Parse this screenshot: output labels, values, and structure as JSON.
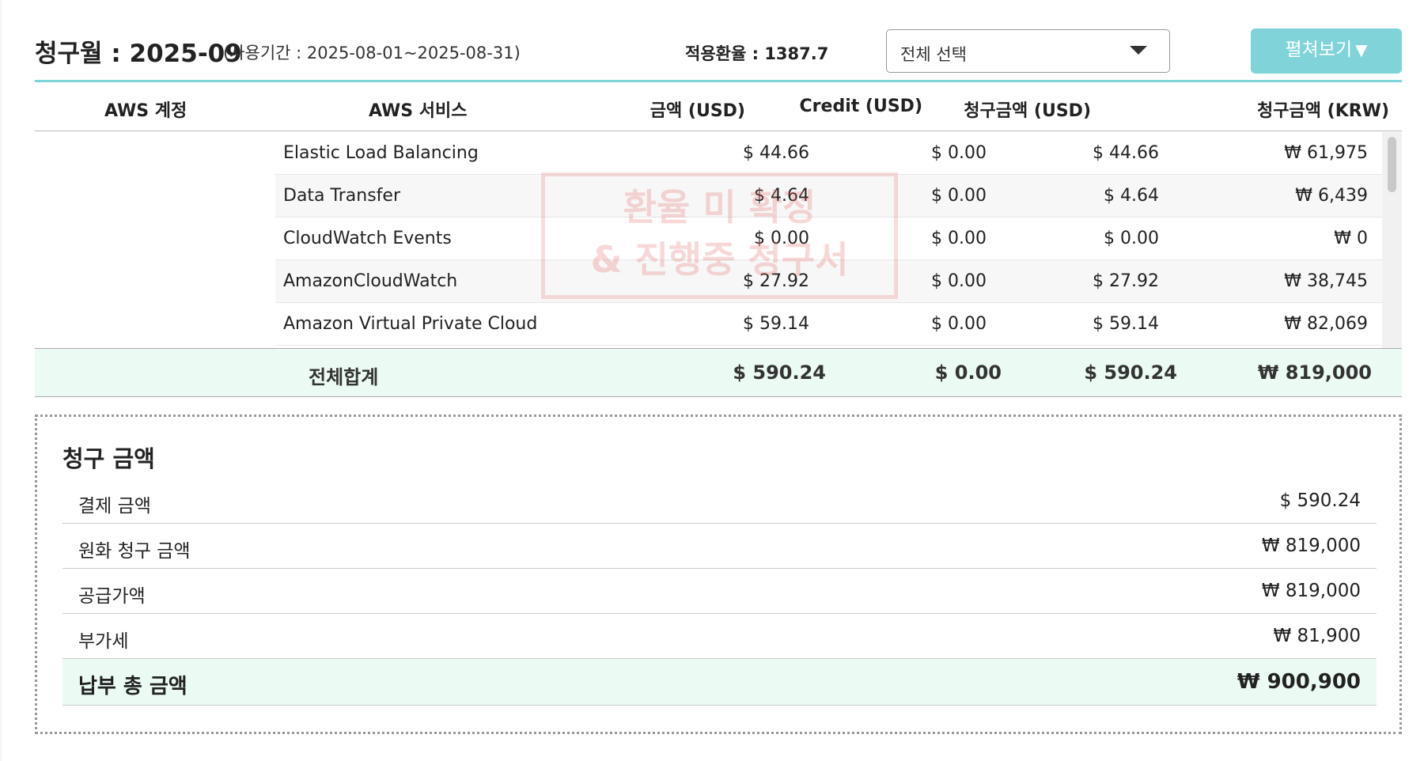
{
  "header": {
    "title": "청구월 : 2025-09",
    "period": "(사용기간 : 2025-08-01~2025-08-31)",
    "rate_label": "적용환율 : ",
    "rate_value": "1387.7",
    "select_value": "전체 선택",
    "expand_label": "펼쳐보기",
    "expand_icon": "▼"
  },
  "table": {
    "columns": [
      "AWS 계정",
      "AWS 서비스",
      "금액 (USD)",
      "Credit (USD)",
      "청구금액 (USD)",
      "청구금액 (KRW)"
    ],
    "rows": [
      {
        "service": "Elastic Load Balancing",
        "amount": "$ 44.66",
        "credit": "$ 0.00",
        "bill_usd": "$ 44.66",
        "bill_krw": "₩ 61,975"
      },
      {
        "service": "Data Transfer",
        "amount": "$ 4.64",
        "credit": "$ 0.00",
        "bill_usd": "$ 4.64",
        "bill_krw": "₩ 6,439"
      },
      {
        "service": "CloudWatch Events",
        "amount": "$ 0.00",
        "credit": "$ 0.00",
        "bill_usd": "$ 0.00",
        "bill_krw": "₩ 0"
      },
      {
        "service": "AmazonCloudWatch",
        "amount": "$ 27.92",
        "credit": "$ 0.00",
        "bill_usd": "$ 27.92",
        "bill_krw": "₩ 38,745"
      },
      {
        "service": "Amazon Virtual Private Cloud",
        "amount": "$ 59.14",
        "credit": "$ 0.00",
        "bill_usd": "$ 59.14",
        "bill_krw": "₩ 82,069"
      }
    ],
    "total": {
      "label": "전체합계",
      "amount": "$ 590.24",
      "credit": "$ 0.00",
      "bill_usd": "$ 590.24",
      "bill_krw": "₩ 819,000"
    }
  },
  "watermark": {
    "line1": "환율 미 확정",
    "line2": "& 진행중 청구서"
  },
  "summary": {
    "title": "청구 금액",
    "rows": [
      {
        "label": "결제 금액",
        "value": "$ 590.24"
      },
      {
        "label": "원화 청구 금액",
        "value": "₩ 819,000"
      },
      {
        "label": "공급가액",
        "value": "₩ 819,000"
      },
      {
        "label": "부가세",
        "value": "₩ 81,900"
      }
    ],
    "final": {
      "label": "납부 총 금액",
      "value": "₩ 900,900"
    }
  },
  "colors": {
    "accent": "#7fd3d9",
    "highlight_bg": "#ebfbf3"
  },
  "icons": {
    "select_arrow": "caret-down-icon",
    "expand": "triangle-down-icon"
  }
}
